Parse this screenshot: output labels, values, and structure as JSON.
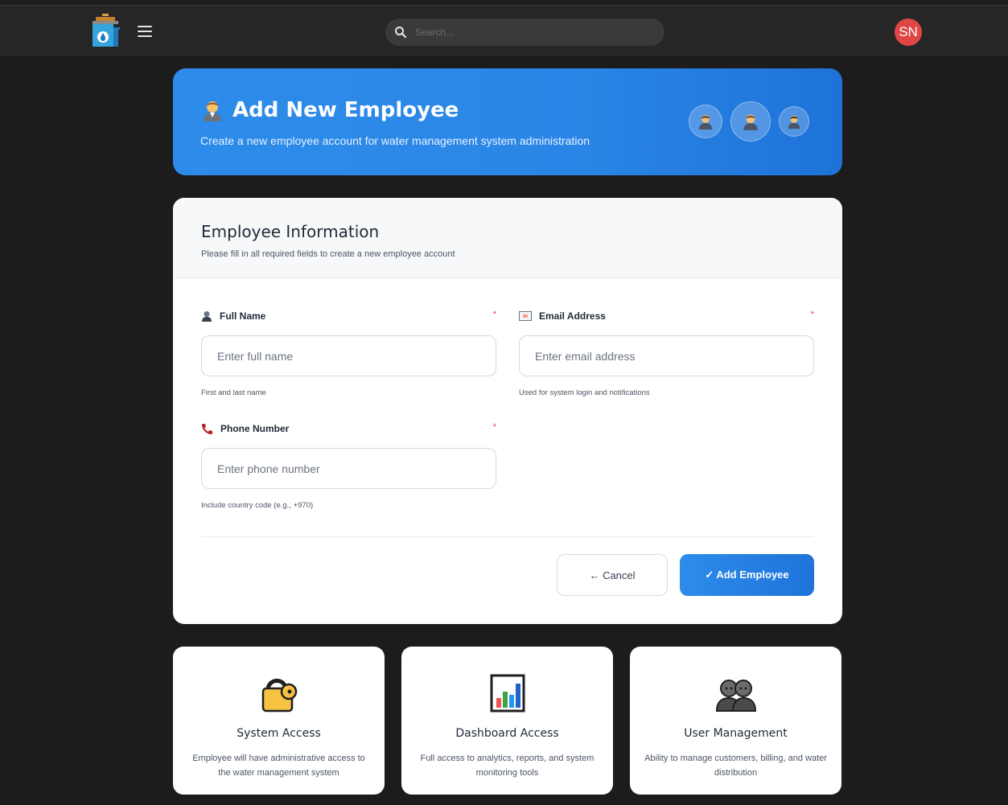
{
  "topbar": {
    "search_placeholder": "Search...",
    "avatar_initials": "SN"
  },
  "hero": {
    "title": "Add New Employee",
    "subtitle": "Create a new employee account for water management system administration"
  },
  "form": {
    "title": "Employee Information",
    "description": "Please fill in all required fields to create a new employee account",
    "required_mark": "*",
    "full_name": {
      "label": "Full Name",
      "placeholder": "Enter full name",
      "hint": "First and last name",
      "value": ""
    },
    "email": {
      "label": "Email Address",
      "placeholder": "Enter email address",
      "hint": "Used for system login and notifications",
      "value": ""
    },
    "phone": {
      "label": "Phone Number",
      "placeholder": "Enter phone number",
      "hint": "Include country code (e.g., +970)",
      "value": ""
    },
    "cancel_label": "← Cancel",
    "submit_label": "✓ Add Employee"
  },
  "features": [
    {
      "icon": "lock-icon",
      "title": "System Access",
      "description": "Employee will have administrative access to the water management system"
    },
    {
      "icon": "bar-chart-icon",
      "title": "Dashboard Access",
      "description": "Full access to analytics, reports, and system monitoring tools"
    },
    {
      "icon": "users-icon",
      "title": "User Management",
      "description": "Ability to manage customers, billing, and water distribution"
    }
  ],
  "colors": {
    "accent": "#2d8cea",
    "avatar": "#e04646",
    "required": "#ef4444",
    "background": "#1c1c1d"
  }
}
